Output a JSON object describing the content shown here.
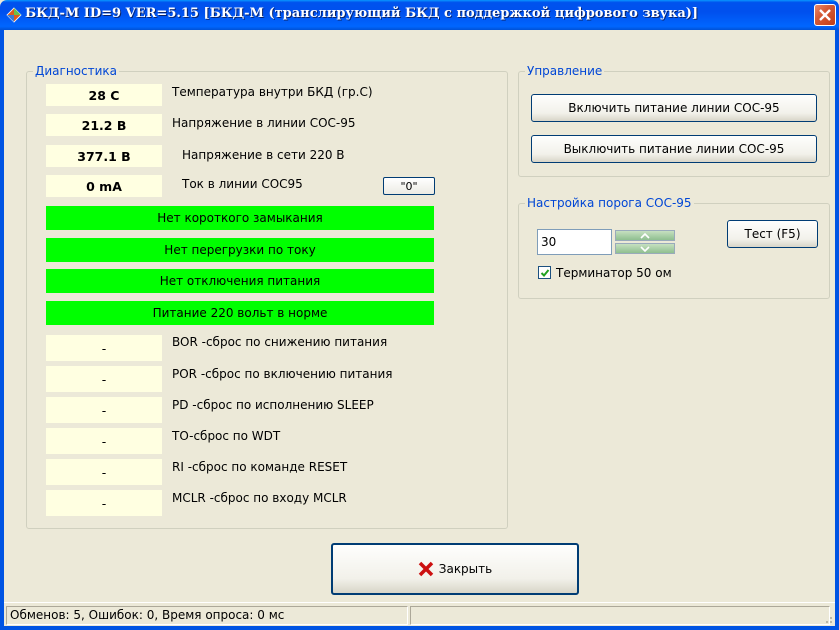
{
  "window": {
    "title": "БКД-М ID=9 VER=5.15 [БКД-М (транслирующий БКД с поддержкой цифрового звука)]",
    "close_icon": "close-icon",
    "app_icon": "diamond-icon"
  },
  "diagnostics": {
    "legend": "Диагностика",
    "readings": [
      {
        "value": "28 C",
        "label": "Температура внутри БКД (гр.С)"
      },
      {
        "value": "21.2 В",
        "label": "Напряжение в линии СОС-95"
      },
      {
        "value": "377.1 В",
        "label": "Напряжение в  сети 220 В"
      },
      {
        "value": "0 mA",
        "label": "Ток в линии СОС95"
      }
    ],
    "zero_button": "\"0\"",
    "status_bars": [
      "Нет короткого замыкания",
      "Нет перегрузки по току",
      "Нет отключения питания",
      "Питание 220 вольт в норме"
    ],
    "reset_flags": [
      {
        "value": "-",
        "label": "BOR -сброс по снижению питания"
      },
      {
        "value": "-",
        "label": "POR -сброс по включению питания"
      },
      {
        "value": "-",
        "label": "PD -сброс по исполнению SLEEP"
      },
      {
        "value": "-",
        "label": "TO-сброс по WDT"
      },
      {
        "value": "-",
        "label": "RI -сброс по команде RESET"
      },
      {
        "value": "-",
        "label": "MCLR -сброс по входу MCLR"
      }
    ],
    "ok_color": "#00ff00",
    "value_bg": "#ffffe1"
  },
  "control": {
    "legend": "Управление",
    "power_on": "Включить питание линии СОС-95",
    "power_off": "Выключить питание линии СОС-95"
  },
  "threshold": {
    "legend": "Настройка порога СОС-95",
    "value": "30",
    "test_button": "Тест (F5)",
    "terminator_label": "Терминатор 50 ом",
    "terminator_checked": true
  },
  "close_button": {
    "label": "Закрыть",
    "icon": "red-x-icon"
  },
  "statusbar": {
    "text": "Обменов: 5, Ошибок: 0, Время опроса: 0 мс"
  },
  "colors": {
    "titlebar": "#0054e3",
    "legend_text": "#0046d5",
    "face": "#ece9d8"
  }
}
